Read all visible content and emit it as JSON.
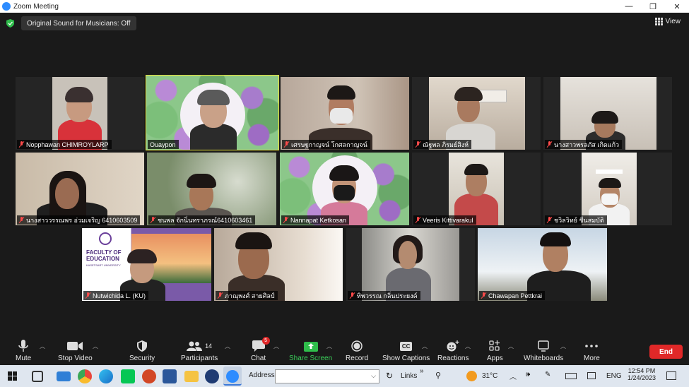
{
  "window": {
    "title": "Zoom Meeting",
    "minimize": "—",
    "restore": "❐",
    "close": "✕"
  },
  "topbar": {
    "original_sound": "Original Sound for Musicians: Off",
    "view_label": "View"
  },
  "participants": [
    {
      "name": "Nopphawan CHIMROYLARP",
      "muted": true
    },
    {
      "name": "Ouaypon",
      "muted": false,
      "active_speaker": true
    },
    {
      "name": "เศรษฐกาญจน์ โกศลกาญจน์",
      "muted": true
    },
    {
      "name": "ณัฐพล ภิรมย์สิงห์",
      "muted": true
    },
    {
      "name": "นางสาวพรลภัส เกิดแก้ว",
      "muted": true
    },
    {
      "name": "นางสาววรรณพร อ่วมเจริญ 6410603509",
      "muted": true
    },
    {
      "name": "ชนพล จักนิ่นทราภรณ์6410603461",
      "muted": true
    },
    {
      "name": "Nannapat Ketkosan",
      "muted": true
    },
    {
      "name": "Veeris Kittivarakul",
      "muted": true
    },
    {
      "name": "ชวิลวิทย์ ชื่นสมบัติ",
      "muted": true
    },
    {
      "name": "Nutwichida L. (KU)",
      "muted": true
    },
    {
      "name": "ภาณุพงศ์ สายศิลป์",
      "muted": true
    },
    {
      "name": "ทิพวรรณ กลิ่นประยงค์",
      "muted": true
    },
    {
      "name": "Chawapan Pettkrai",
      "muted": true
    }
  ],
  "background_text": {
    "faculty_line1": "FACULTY OF",
    "faculty_line2": "EDUCATION",
    "faculty_line3": "KASETSART UNIVERSITY"
  },
  "toolbar": {
    "mute": "Mute",
    "stop_video": "Stop Video",
    "security": "Security",
    "participants": "Participants",
    "participants_count": "14",
    "chat": "Chat",
    "chat_badge": "5",
    "share_screen": "Share Screen",
    "record": "Record",
    "show_captions": "Show Captions",
    "captions_glyph": "CC",
    "reactions": "Reactions",
    "apps": "Apps",
    "whiteboards": "Whiteboards",
    "more": "More",
    "end": "End"
  },
  "taskbar": {
    "address_label": "Address",
    "address_value": "",
    "links_label": "Links",
    "links_chevron": "»",
    "temperature": "31°C",
    "language": "ENG",
    "time": "12:54 PM",
    "date": "1/24/2023"
  },
  "colors": {
    "share_green": "#2fbd4b",
    "end_red": "#e02828",
    "active_yellow": "#e8e23a",
    "muted_red": "#ff4a4a",
    "zoom_blue": "#2d8cff"
  }
}
